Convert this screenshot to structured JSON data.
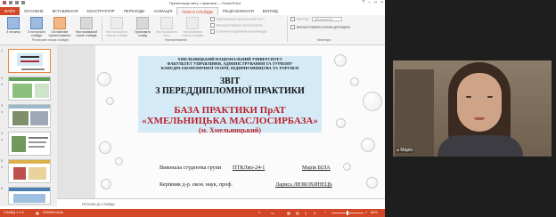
{
  "window": {
    "title": "Презентація звіту з практики — PowerPoint",
    "controls": [
      "?",
      "–",
      "□",
      "×"
    ]
  },
  "ribbon": {
    "tabs": [
      "ФАЙЛ",
      "ОСНОВНЕ",
      "ВСТАВЛЕННЯ",
      "КОНСТРУКТОР",
      "ПЕРЕХОДИ",
      "АНІМАЦІЯ",
      "ПОКАЗ СЛАЙДІВ",
      "РЕЦЕНЗУВАННЯ",
      "ВИГЛЯД"
    ],
    "active_tab": "ПОКАЗ СЛАЙДІВ",
    "buttons": [
      {
        "label": "З початку",
        "enabled": true
      },
      {
        "label": "З поточного слайда",
        "enabled": true
      },
      {
        "label": "Онлайнове презентування",
        "enabled": true
      },
      {
        "label": "Настроюваний показ слайдів",
        "enabled": true
      },
      {
        "label": "Настроювання показу слайдів",
        "enabled": false
      },
      {
        "label": "Приховати слайд",
        "enabled": true
      },
      {
        "label": "Настроювання часу",
        "enabled": false
      },
      {
        "label": "Записування показу слайдів",
        "enabled": false
      }
    ],
    "checkboxes": [
      {
        "label": "Відтворювати дикторський текст",
        "checked": false
      },
      {
        "label": "Використовувати хронометраж",
        "checked": false
      },
      {
        "label": "Елементи керування мультимедіа",
        "checked": false
      },
      {
        "label": "Використовувати режим доповідача",
        "checked": true
      }
    ],
    "monitor_label": "Монітор:",
    "monitor_value": "Автоматично",
    "groups": [
      "Розпочати показ слайдів",
      "Настроювання",
      "Монітори"
    ]
  },
  "thumbnails": {
    "numbers": [
      "1",
      "2",
      "3",
      "4",
      "5",
      "6"
    ],
    "selected_index": 1
  },
  "slide": {
    "university": "ХМЕЛЬНИЦЬКИЙ НАЦІОНАЛЬНИЙ УНІВЕРСИТЕТ",
    "faculty": "ФАКУЛЬТЕТ УПРАВЛІННЯ, АДМІНІСТРУВАННЯ ТА ТУРИЗМУ",
    "department": "КАФЕДРА ЕКОНОМІЧНОЇ ТЕОРІЇ, ПІДПРИЄМНИЦТВА ТА ТОРГІВЛІ",
    "report_title_1": "ЗВІТ",
    "report_title_2": "З ПЕРЕДДИПЛОМНОЇ ПРАКТИКИ",
    "base_label": "БАЗА ПРАКТИКИ ПрАТ",
    "company_name": "«ХМЕЛЬНИЦЬКА МАСЛОСИРБАЗА»",
    "city": "(м. Хмельницький)",
    "performer_label": "Виконала студентка групи",
    "group_code": "ПТКЛмз-24-1",
    "student_name": "Марія БІЛА",
    "supervisor_label": "Керівник д-р. екон. наук, проф.",
    "supervisor_name": "Лариса ЛЮБОХИНЕЦЬ"
  },
  "notes": {
    "placeholder": "Нотатки до слайда"
  },
  "status_bar": {
    "slide_counter": "СЛАЙД 1 З 6",
    "language": "УКРАЇНСЬКА",
    "zoom": "66%"
  },
  "video": {
    "participant_name": "Марія"
  },
  "colors": {
    "accent": "#d24726",
    "slide_band": "#d4ebf7",
    "company_red": "#b8232d"
  }
}
